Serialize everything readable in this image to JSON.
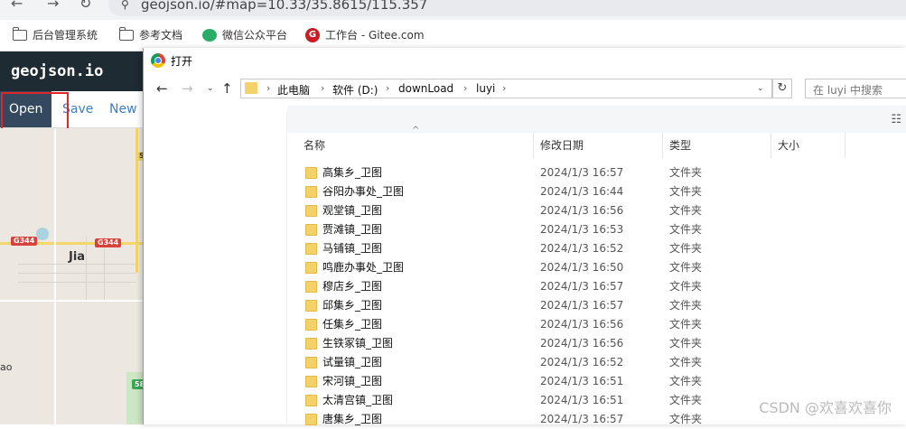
{
  "browser": {
    "url": "geojson.io/#map=10.33/35.8615/115.357",
    "bookmarks": [
      {
        "label": "后台管理系统",
        "icon": "folder-icon"
      },
      {
        "label": "参考文档",
        "icon": "folder-icon"
      },
      {
        "label": "微信公众平台",
        "icon": "wechat-icon"
      },
      {
        "label": "工作台 - Gitee.com",
        "icon": "gitee-icon"
      }
    ]
  },
  "app": {
    "title": "geojson.io",
    "menu": {
      "open": "Open",
      "save": "Save",
      "new": "New"
    },
    "map": {
      "labels": {
        "town": "Jia",
        "edge": "ao"
      },
      "shields": [
        "G344",
        "G344",
        "S",
        "58"
      ]
    }
  },
  "dialog": {
    "title": "打开",
    "path": [
      "此电脑",
      "软件 (D:)",
      "downLoad",
      "luyi"
    ],
    "search_placeholder": "在 luyi 中搜索",
    "columns": {
      "name": "名称",
      "date": "修改日期",
      "type": "类型",
      "size": "大小"
    },
    "files": [
      {
        "name": "高集乡_卫图",
        "date": "2024/1/3 16:57",
        "type": "文件夹"
      },
      {
        "name": "谷阳办事处_卫图",
        "date": "2024/1/3 16:44",
        "type": "文件夹"
      },
      {
        "name": "观堂镇_卫图",
        "date": "2024/1/3 16:56",
        "type": "文件夹"
      },
      {
        "name": "贾滩镇_卫图",
        "date": "2024/1/3 16:53",
        "type": "文件夹"
      },
      {
        "name": "马铺镇_卫图",
        "date": "2024/1/3 16:52",
        "type": "文件夹"
      },
      {
        "name": "鸣鹿办事处_卫图",
        "date": "2024/1/3 16:50",
        "type": "文件夹"
      },
      {
        "name": "穆店乡_卫图",
        "date": "2024/1/3 16:57",
        "type": "文件夹"
      },
      {
        "name": "邱集乡_卫图",
        "date": "2024/1/3 16:57",
        "type": "文件夹"
      },
      {
        "name": "任集乡_卫图",
        "date": "2024/1/3 16:56",
        "type": "文件夹"
      },
      {
        "name": "生铁冢镇_卫图",
        "date": "2024/1/3 16:56",
        "type": "文件夹"
      },
      {
        "name": "试量镇_卫图",
        "date": "2024/1/3 16:52",
        "type": "文件夹"
      },
      {
        "name": "宋河镇_卫图",
        "date": "2024/1/3 16:51",
        "type": "文件夹"
      },
      {
        "name": "太清宫镇_卫图",
        "date": "2024/1/3 16:51",
        "type": "文件夹"
      },
      {
        "name": "唐集乡_卫图",
        "date": "2024/1/3 16:57",
        "type": "文件夹"
      }
    ]
  },
  "watermark": "CSDN @欢喜欢喜你"
}
